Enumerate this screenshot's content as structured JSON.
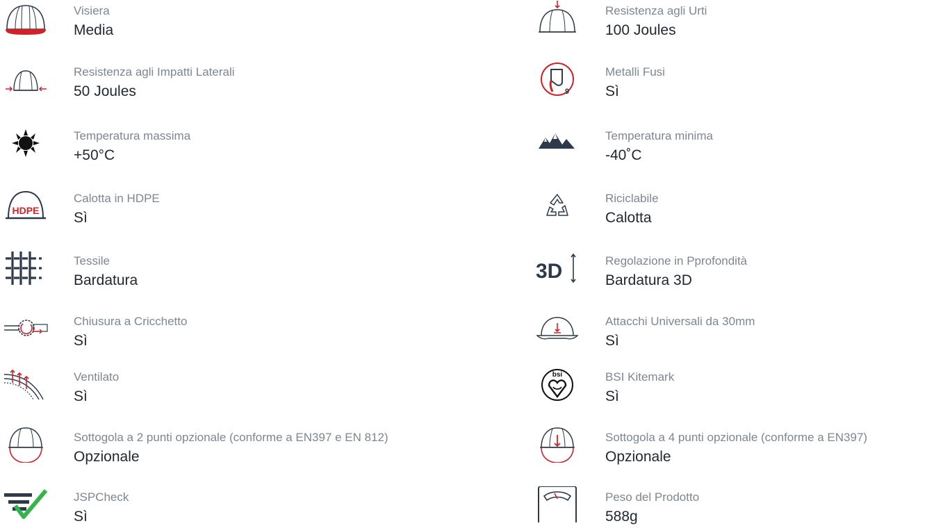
{
  "colors": {
    "label": "#7d8691",
    "value": "#222831",
    "accent": "#d42027",
    "icon": "#2c3a4b",
    "check": "#35b44a"
  },
  "left_column": [
    {
      "icon": "helmet-visor-icon",
      "label": "Visiera",
      "value": "Media"
    },
    {
      "icon": "helmet-side-impact-icon",
      "label": "Resistenza agli Impatti Laterali",
      "value": "50 Joules"
    },
    {
      "icon": "sun-icon",
      "label": "Temperatura massima",
      "value": "+50°C"
    },
    {
      "icon": "helmet-hdpe-icon",
      "icon_text": "HDPE",
      "label": "Calotta in HDPE",
      "value": "Sì"
    },
    {
      "icon": "textile-grid-icon",
      "label": "Tessile",
      "value": "Bardatura"
    },
    {
      "icon": "ratchet-icon",
      "label": "Chiusura a Cricchetto",
      "value": "Sì"
    },
    {
      "icon": "ventilation-icon",
      "label": "Ventilato",
      "value": "Sì"
    },
    {
      "icon": "helmet-chinstrap-2pt-icon",
      "label": "Sottogola a 2 punti opzionale (conforme a EN397 e EN 812)",
      "value": "Opzionale"
    },
    {
      "icon": "jspcheck-icon",
      "label": "JSPCheck",
      "value": "Sì"
    }
  ],
  "right_column": [
    {
      "icon": "helmet-impact-icon",
      "label": "Resistenza agli Urti",
      "value": "100 Joules"
    },
    {
      "icon": "molten-metal-icon",
      "icon_text": "9",
      "label": "Metalli Fusi",
      "value": "Sì"
    },
    {
      "icon": "mountains-icon",
      "label": "Temperatura minima",
      "value": "-40˚C"
    },
    {
      "icon": "recycle-icon",
      "label": "Riciclabile",
      "value": "Calotta"
    },
    {
      "icon": "depth-3d-icon",
      "icon_text": "3D",
      "label": "Regolazione in Pprofondità",
      "value": "Bardatura 3D"
    },
    {
      "icon": "helmet-attachment-icon",
      "label": "Attacchi Universali da 30mm",
      "value": "Sì"
    },
    {
      "icon": "bsi-kitemark-icon",
      "icon_text": "bsi",
      "label": "BSI Kitemark",
      "value": "Sì"
    },
    {
      "icon": "helmet-chinstrap-4pt-icon",
      "label": "Sottogola a 4 punti opzionale (conforme a EN397)",
      "value": "Opzionale"
    },
    {
      "icon": "scale-icon",
      "label": "Peso del Prodotto",
      "value": "588g"
    }
  ]
}
